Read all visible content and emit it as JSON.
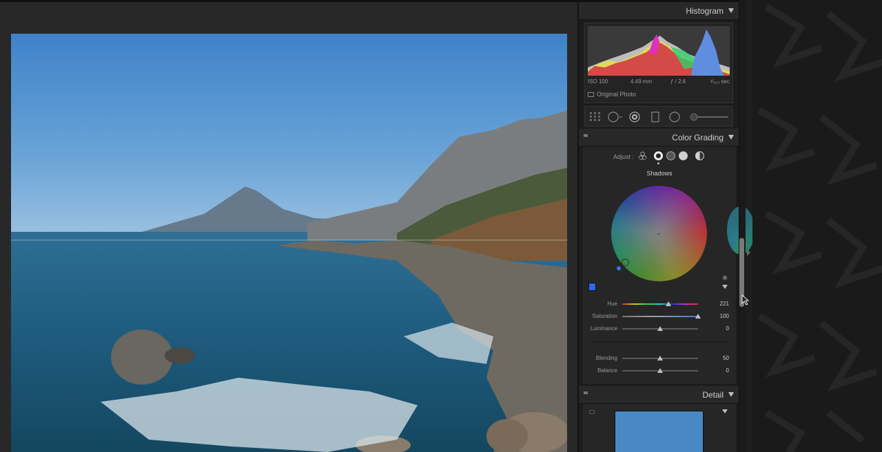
{
  "histogram": {
    "title": "Histogram",
    "iso": "ISO 100",
    "focal_length": "4.49 mm",
    "aperture": "ƒ / 2.6",
    "shutter": "¹⁄₆₄₃ sec",
    "original_photo_label": "Original Photo"
  },
  "color_grading": {
    "title": "Color Grading",
    "adjust_label": "Adjust :",
    "mode_label": "Shadows",
    "swatch_color": "#2c6ae8",
    "sliders": [
      {
        "label": "Hue",
        "value": "221",
        "fraction": 0.61
      },
      {
        "label": "Saturation",
        "value": "100",
        "fraction": 1.0
      },
      {
        "label": "Luminance",
        "value": "0",
        "fraction": 0.5
      },
      {
        "label": "Blending",
        "value": "50",
        "fraction": 0.5
      },
      {
        "label": "Balance",
        "value": "0",
        "fraction": 0.5
      }
    ]
  },
  "detail": {
    "title": "Detail"
  },
  "icons": {
    "collapse": "triangle-down-icon",
    "eye": "eye-icon"
  }
}
